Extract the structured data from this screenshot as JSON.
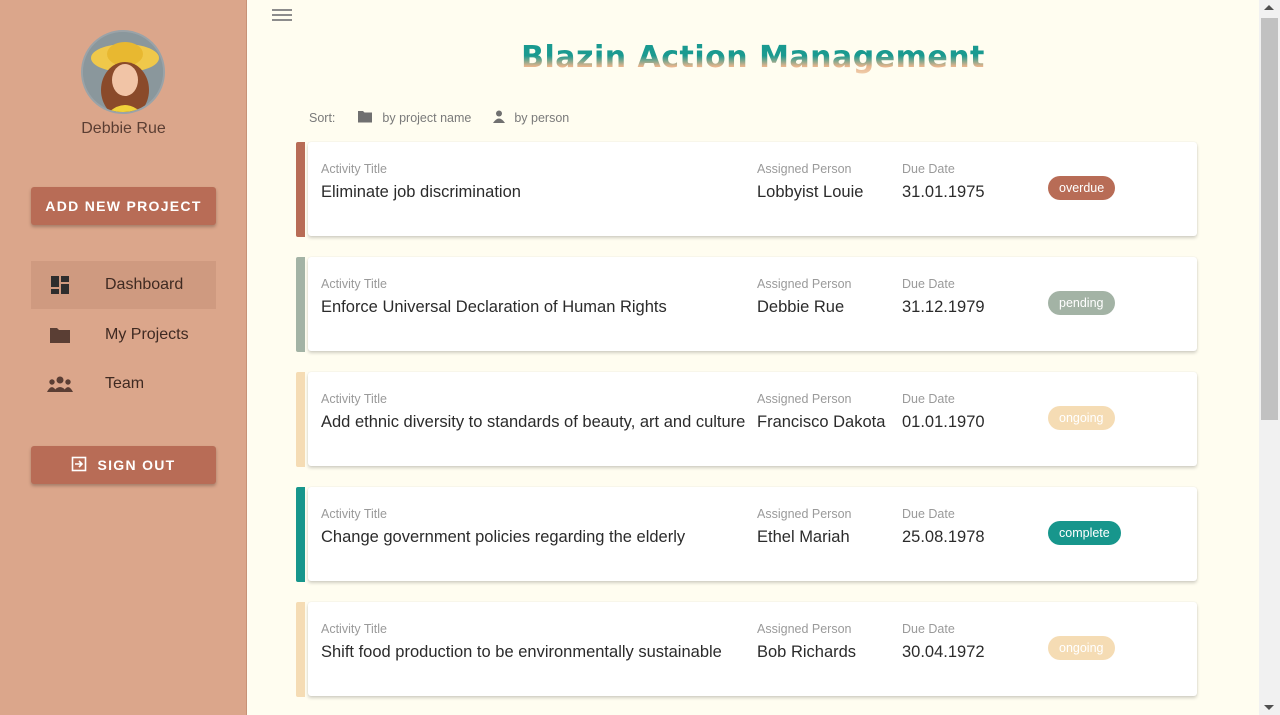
{
  "user": {
    "name": "Debbie Rue"
  },
  "sidebar": {
    "add_project_label": "ADD NEW PROJECT",
    "items": [
      {
        "label": "Dashboard",
        "icon": "dashboard-icon",
        "active": true
      },
      {
        "label": "My Projects",
        "icon": "folder-icon",
        "active": false
      },
      {
        "label": "Team",
        "icon": "group-icon",
        "active": false
      }
    ],
    "signout_label": "SIGN OUT"
  },
  "header": {
    "title": "Blazin Action Management"
  },
  "sort": {
    "label": "Sort:",
    "by_project": "by project name",
    "by_person": "by person"
  },
  "labels": {
    "title": "Activity Title",
    "person": "Assigned Person",
    "due": "Due Date"
  },
  "activities": [
    {
      "title": "Eliminate job discrimination",
      "person": "Lobbyist Louie",
      "due": "31.01.1975",
      "status": "overdue"
    },
    {
      "title": "Enforce Universal Declaration of Human Rights",
      "person": "Debbie Rue",
      "due": "31.12.1979",
      "status": "pending"
    },
    {
      "title": "Add ethnic diversity to standards of beauty, art and culture",
      "person": "Francisco Dakota",
      "due": "01.01.1970",
      "status": "ongoing"
    },
    {
      "title": "Change government policies regarding the elderly",
      "person": "Ethel Mariah",
      "due": "25.08.1978",
      "status": "complete"
    },
    {
      "title": "Shift food production to be environmentally sustainable",
      "person": "Bob Richards",
      "due": "30.04.1972",
      "status": "ongoing"
    }
  ],
  "status_colors": {
    "overdue": "#b86c56",
    "pending": "#a3b3a5",
    "ongoing": "#f5dcb4",
    "complete": "#17968c"
  }
}
